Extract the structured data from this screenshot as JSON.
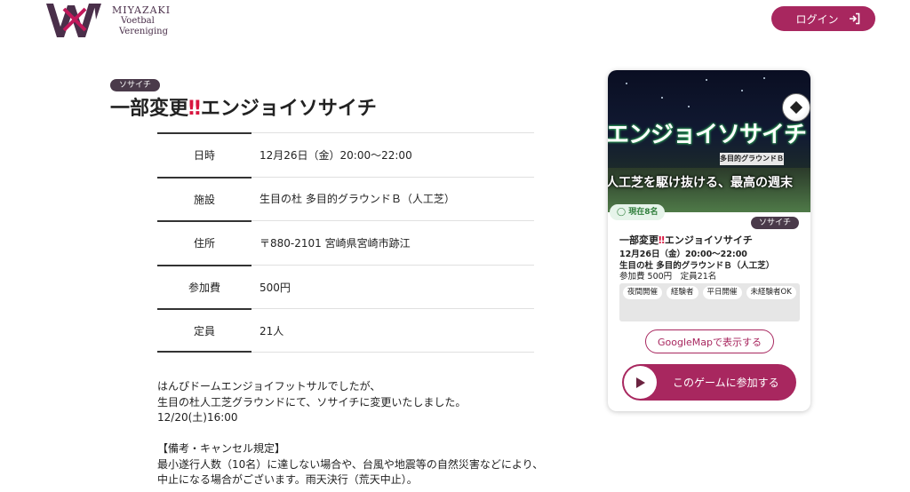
{
  "header": {
    "logo_line1": "MIYAZAKI",
    "logo_line2": "Voetbal",
    "logo_line3": "Vereniging",
    "login_label": "ログイン"
  },
  "event": {
    "category": "ソサイチ",
    "title_prefix": "一部変更",
    "title_alarm": "‼",
    "title_suffix": "エンジョイソサイチ",
    "details": [
      {
        "label": "日時",
        "value": "12月26日（金）20:00〜22:00"
      },
      {
        "label": "施設",
        "value": "生目の杜 多目的グラウンドＢ（人工芝）"
      },
      {
        "label": "住所",
        "value": "〒880-2101 宮崎県宮崎市跡江"
      },
      {
        "label": "参加費",
        "value": "500円"
      },
      {
        "label": "定員",
        "value": "21人"
      }
    ],
    "description": [
      "はんぴドームエンジョイフットサルでしたが、",
      "生目の杜人工芝グラウンドにて、ソサイチに変更いたしました。",
      "12/20(土)16:00",
      "",
      "【備考・キャンセル規定】",
      "最小遂行人数（10名）に達しない場合や、台風や地震等の自然災害などにより、",
      "中止になる場合がございます。雨天決行（荒天中止）。"
    ]
  },
  "card": {
    "banner_title": "エンジョイソサイチ",
    "banner_sign": "多目的グラウンドＢ",
    "banner_subtitle": "人工芝を駆け抜ける、最高の週末",
    "current_count": "◯ 現在8名",
    "category": "ソサイチ",
    "title_prefix": "一部変更",
    "title_alarm": "‼",
    "title_suffix": "エンジョイソサイチ",
    "datetime": "12月26日（金）20:00〜22:00",
    "venue": "生目の杜 多目的グラウンドＢ（人工芝）",
    "fee_capacity": "参加費 500円　定員21名",
    "tags": [
      "夜間開催",
      "経験者",
      "平日開催",
      "未経験者OK"
    ],
    "map_button": "GoogleMapで表示する",
    "join_button": "このゲームに参加する"
  },
  "colors": {
    "brand": "#a8275f",
    "badge": "#4a3a4a",
    "alarm": "#d8163f"
  }
}
